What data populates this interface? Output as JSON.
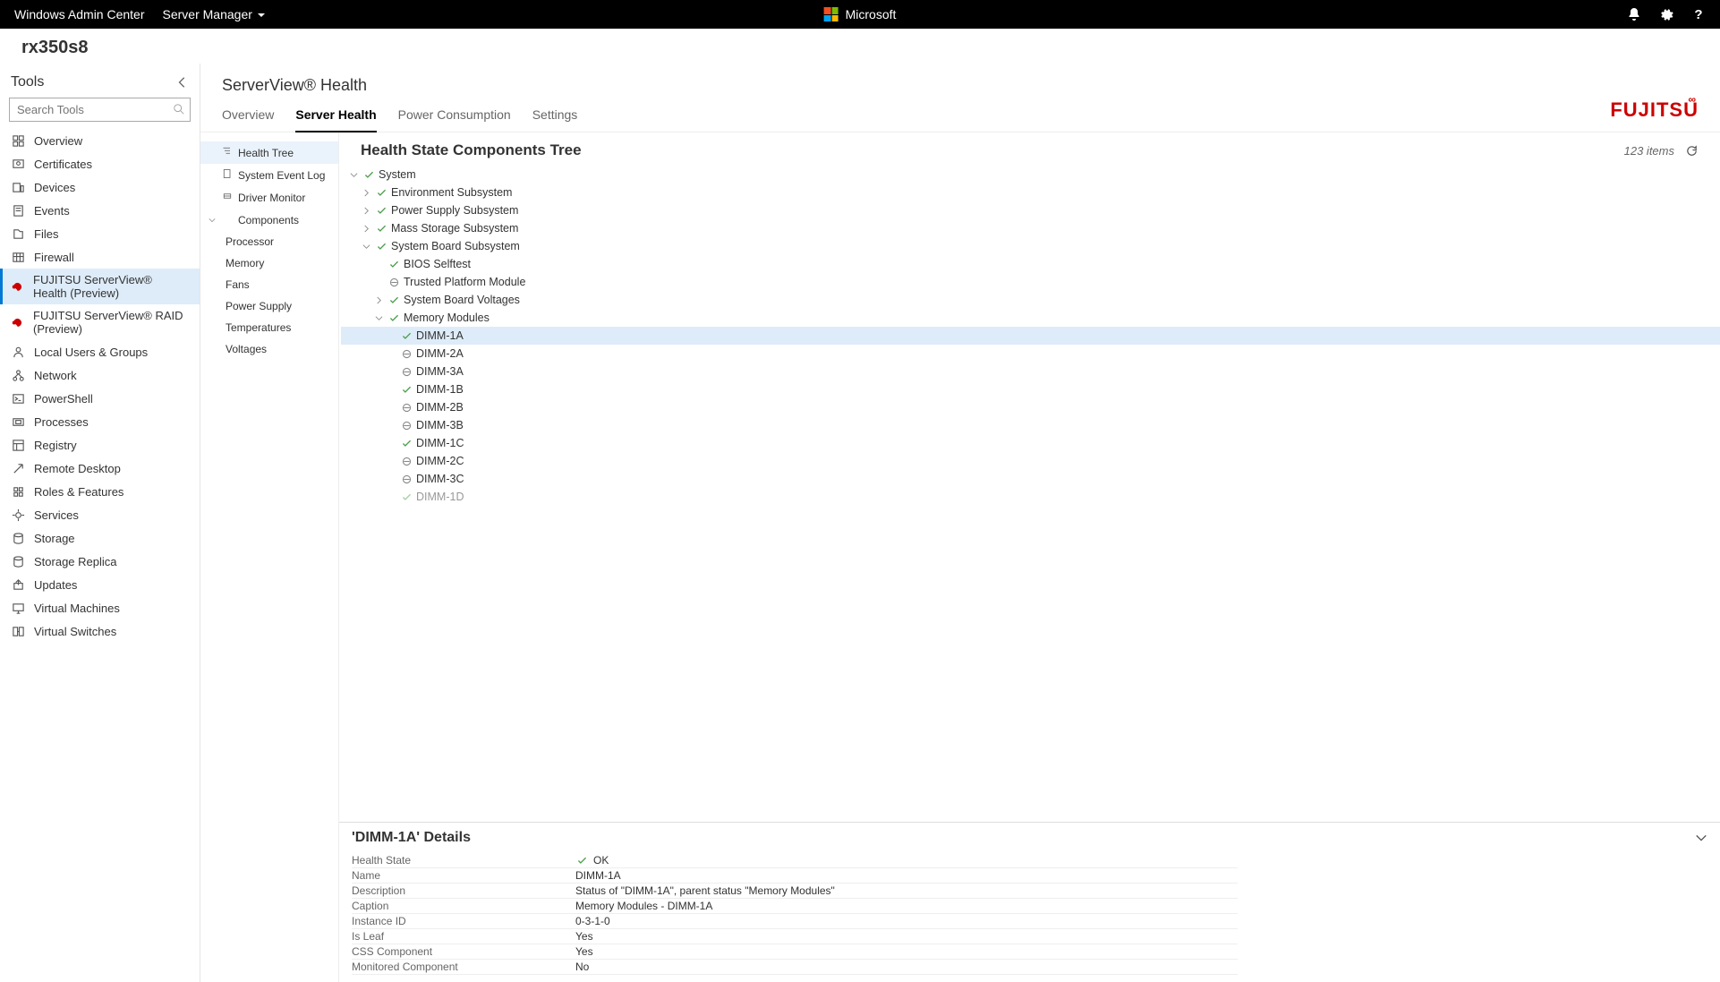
{
  "topbar": {
    "app": "Windows Admin Center",
    "menu": "Server Manager",
    "brand": "Microsoft"
  },
  "serverName": "rx350s8",
  "toolsPanel": {
    "title": "Tools",
    "searchPlaceholder": "Search Tools"
  },
  "tools": [
    {
      "label": "Overview",
      "icon": "overview"
    },
    {
      "label": "Certificates",
      "icon": "cert"
    },
    {
      "label": "Devices",
      "icon": "devices"
    },
    {
      "label": "Events",
      "icon": "events"
    },
    {
      "label": "Files",
      "icon": "files"
    },
    {
      "label": "Firewall",
      "icon": "firewall"
    },
    {
      "label": "FUJITSU ServerView® Health (Preview)",
      "icon": "fujitsu",
      "selected": true
    },
    {
      "label": "FUJITSU ServerView® RAID (Preview)",
      "icon": "fujitsu"
    },
    {
      "label": "Local Users & Groups",
      "icon": "users"
    },
    {
      "label": "Network",
      "icon": "network"
    },
    {
      "label": "PowerShell",
      "icon": "ps"
    },
    {
      "label": "Processes",
      "icon": "proc"
    },
    {
      "label": "Registry",
      "icon": "reg"
    },
    {
      "label": "Remote Desktop",
      "icon": "rdp"
    },
    {
      "label": "Roles & Features",
      "icon": "roles"
    },
    {
      "label": "Services",
      "icon": "svc"
    },
    {
      "label": "Storage",
      "icon": "storage"
    },
    {
      "label": "Storage Replica",
      "icon": "storage"
    },
    {
      "label": "Updates",
      "icon": "updates"
    },
    {
      "label": "Virtual Machines",
      "icon": "vm"
    },
    {
      "label": "Virtual Switches",
      "icon": "vs"
    }
  ],
  "pageTitle": "ServerView® Health",
  "tabs": [
    {
      "label": "Overview"
    },
    {
      "label": "Server Health",
      "active": true
    },
    {
      "label": "Power Consumption"
    },
    {
      "label": "Settings"
    }
  ],
  "brandLogo": "FUJITSU",
  "subnav": [
    {
      "label": "Health Tree",
      "icon": "tree",
      "selected": true
    },
    {
      "label": "System Event Log",
      "icon": "log"
    },
    {
      "label": "Driver Monitor",
      "icon": "driver"
    },
    {
      "label": "Components",
      "icon": "comp",
      "expanded": true,
      "children": [
        "Processor",
        "Memory",
        "Fans",
        "Power Supply",
        "Temperatures",
        "Voltages"
      ]
    }
  ],
  "tree": {
    "title": "Health State Components Tree",
    "count": "123 items",
    "nodes": [
      {
        "depth": 0,
        "toggle": "down",
        "status": "ok",
        "label": "System"
      },
      {
        "depth": 1,
        "toggle": "right",
        "status": "ok",
        "label": "Environment Subsystem"
      },
      {
        "depth": 1,
        "toggle": "right",
        "status": "ok",
        "label": "Power Supply Subsystem"
      },
      {
        "depth": 1,
        "toggle": "right",
        "status": "ok",
        "label": "Mass Storage Subsystem"
      },
      {
        "depth": 1,
        "toggle": "down",
        "status": "ok",
        "label": "System Board Subsystem"
      },
      {
        "depth": 2,
        "toggle": "",
        "status": "ok",
        "label": "BIOS Selftest"
      },
      {
        "depth": 2,
        "toggle": "",
        "status": "na",
        "label": "Trusted Platform Module"
      },
      {
        "depth": 2,
        "toggle": "right",
        "status": "ok",
        "label": "System Board Voltages"
      },
      {
        "depth": 2,
        "toggle": "down",
        "status": "ok",
        "label": "Memory Modules"
      },
      {
        "depth": 3,
        "toggle": "",
        "status": "ok",
        "label": "DIMM-1A",
        "selected": true
      },
      {
        "depth": 3,
        "toggle": "",
        "status": "na",
        "label": "DIMM-2A"
      },
      {
        "depth": 3,
        "toggle": "",
        "status": "na",
        "label": "DIMM-3A"
      },
      {
        "depth": 3,
        "toggle": "",
        "status": "ok",
        "label": "DIMM-1B"
      },
      {
        "depth": 3,
        "toggle": "",
        "status": "na",
        "label": "DIMM-2B"
      },
      {
        "depth": 3,
        "toggle": "",
        "status": "na",
        "label": "DIMM-3B"
      },
      {
        "depth": 3,
        "toggle": "",
        "status": "ok",
        "label": "DIMM-1C"
      },
      {
        "depth": 3,
        "toggle": "",
        "status": "na",
        "label": "DIMM-2C"
      },
      {
        "depth": 3,
        "toggle": "",
        "status": "na",
        "label": "DIMM-3C"
      },
      {
        "depth": 3,
        "toggle": "",
        "status": "ok",
        "label": "DIMM-1D",
        "cut": true
      }
    ]
  },
  "details": {
    "title": "'DIMM-1A' Details",
    "rows": [
      {
        "label": "Health State",
        "value": "OK",
        "status": "ok"
      },
      {
        "label": "Name",
        "value": "DIMM-1A"
      },
      {
        "label": "Description",
        "value": "Status of \"DIMM-1A\", parent status \"Memory Modules\""
      },
      {
        "label": "Caption",
        "value": "Memory Modules - DIMM-1A"
      },
      {
        "label": "Instance ID",
        "value": "0-3-1-0"
      },
      {
        "label": "Is Leaf",
        "value": "Yes"
      },
      {
        "label": "CSS Component",
        "value": "Yes"
      },
      {
        "label": "Monitored Component",
        "value": "No"
      }
    ]
  }
}
